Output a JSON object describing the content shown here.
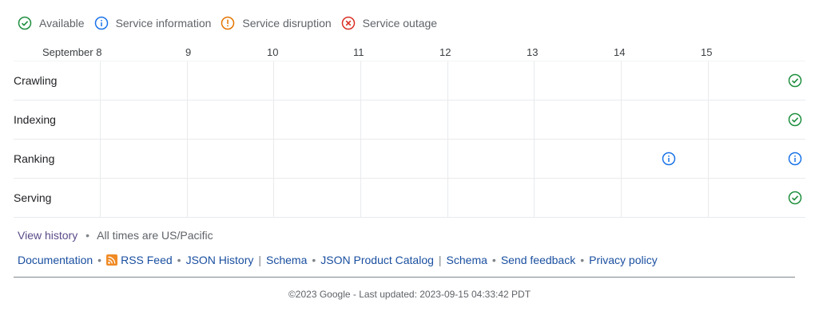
{
  "legend": {
    "available": "Available",
    "info": "Service information",
    "disruption": "Service disruption",
    "outage": "Service outage"
  },
  "dates": [
    "September 8",
    "9",
    "10",
    "11",
    "12",
    "13",
    "14",
    "15"
  ],
  "rows": [
    {
      "label": "Crawling",
      "status": "available"
    },
    {
      "label": "Indexing",
      "status": "available"
    },
    {
      "label": "Ranking",
      "status": "info"
    },
    {
      "label": "Serving",
      "status": "available"
    }
  ],
  "meta": {
    "view_history": "View history",
    "times_note": "All times are US/Pacific"
  },
  "links": {
    "documentation": "Documentation",
    "rss_feed": "RSS Feed",
    "json_history": "JSON History",
    "schema1": "Schema",
    "json_catalog": "JSON Product Catalog",
    "schema2": "Schema",
    "send_feedback": "Send feedback",
    "privacy_policy": "Privacy policy"
  },
  "footer": "©2023 Google - Last updated: 2023-09-15 04:33:42 PDT",
  "colors": {
    "available": "#1e8e3e",
    "info": "#1a73e8",
    "disruption": "#e37400",
    "outage": "#d93025",
    "link": "#1a4fa0"
  }
}
